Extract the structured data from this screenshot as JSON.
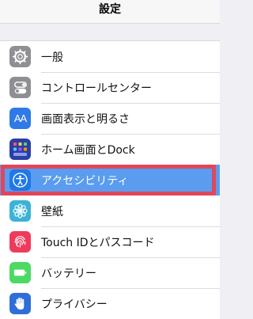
{
  "header": {
    "title": "設定"
  },
  "settings": {
    "items": [
      {
        "label": "一般",
        "icon": "gear-icon",
        "color": "#8e8e93"
      },
      {
        "label": "コントロールセンター",
        "icon": "toggles-icon",
        "color": "#8e8e93"
      },
      {
        "label": "画面表示と明るさ",
        "icon": "text-size-icon",
        "color": "#2f7ae5"
      },
      {
        "label": "ホーム画面とDock",
        "icon": "home-grid-icon",
        "color": "#2c3ea8"
      },
      {
        "label": "アクセシビリティ",
        "icon": "accessibility-icon",
        "color": "#1f78e8",
        "selected": true
      },
      {
        "label": "壁紙",
        "icon": "flower-icon",
        "color": "#3bb3d6"
      },
      {
        "label": "Touch IDとパスコード",
        "icon": "fingerprint-icon",
        "color": "#ef3b5a"
      },
      {
        "label": "バッテリー",
        "icon": "battery-icon",
        "color": "#4cd964"
      },
      {
        "label": "プライバシー",
        "icon": "hand-icon",
        "color": "#2f6ed8"
      }
    ]
  },
  "accent": {
    "selection": "#5a9cf0",
    "highlight_border": "#e0475a"
  },
  "icons": {
    "text_size_glyph": "AA"
  }
}
